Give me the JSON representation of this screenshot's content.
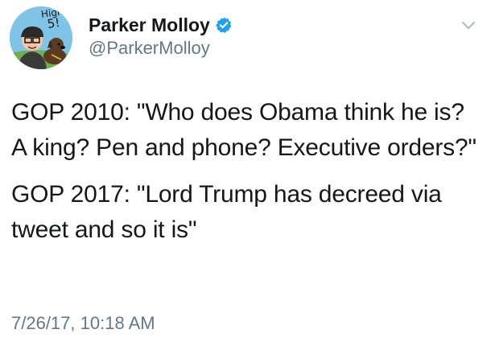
{
  "author": {
    "display_name": "Parker Molloy",
    "handle": "@ParkerMolloy",
    "verified": true,
    "avatar_icon": "illustrated-avatar-with-dog",
    "avatar_caption_top": "High",
    "avatar_caption_bottom": "5!"
  },
  "tweet": {
    "paragraphs": [
      "GOP 2010: \"Who does Obama think he is? A king? Pen and phone? Executive orders?\"",
      "GOP 2017: \"Lord Trump has decreed via tweet and so it is\""
    ],
    "timestamp": "7/26/17, 10:18 AM"
  },
  "icons": {
    "verified": "verified-badge-icon",
    "menu": "chevron-down-icon"
  },
  "colors": {
    "text": "#14171a",
    "secondary": "#657786",
    "verified_blue": "#1da1f2",
    "background": "#ffffff"
  }
}
